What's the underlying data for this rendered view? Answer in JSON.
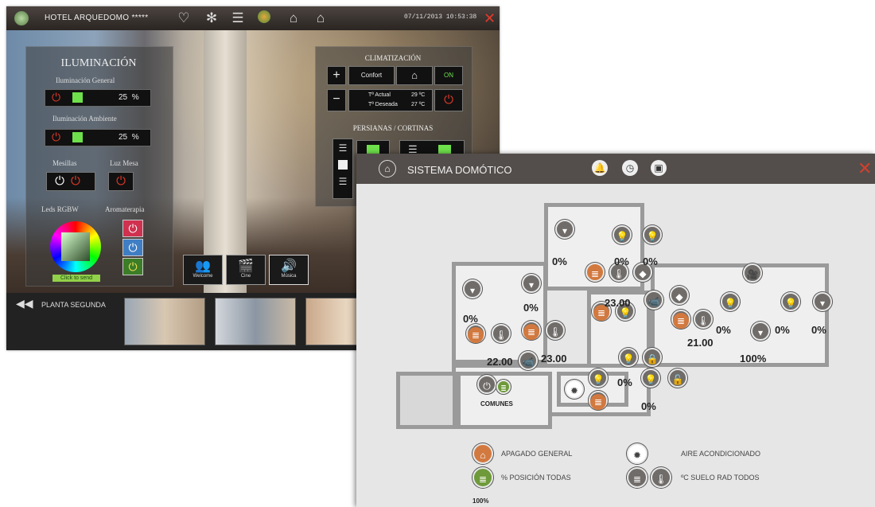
{
  "hotel": {
    "title": "HOTEL ARQUEDOMO *****",
    "datetime": "07/11/2013 10:53:38",
    "close": "✕",
    "toolbar_icons": [
      "bulb-icon",
      "snowflake-icon",
      "blinds-icon",
      "globe-icon",
      "camera-icon",
      "home-icon"
    ],
    "lighting": {
      "heading": "ILUMINACIÓN",
      "general_label": "Iluminación General",
      "general_value": "25",
      "ambient_label": "Iluminación Ambiente",
      "ambient_value": "25",
      "unit": "%",
      "mesillas_label": "Mesillas",
      "luz_mesa_label": "Luz Mesa",
      "leds_label": "Leds RGBW",
      "aroma_label": "Aromaterapia",
      "click_to_send": "Click to send"
    },
    "climate": {
      "heading": "CLIMATIZACIÓN",
      "mode": "Confort",
      "state": "ON",
      "actual_label": "Tª Actual",
      "actual_value": "29 ºC",
      "desired_label": "Tª Deseada",
      "desired_value": "27 ºC",
      "blinds_heading": "PERSIANAS / CORTINAS"
    },
    "scenes": [
      "Welcome",
      "Cine",
      "Música"
    ],
    "floor_label": "PLANTA SEGUNDA"
  },
  "domotic": {
    "title": "SISTEMA DOMÓTICO",
    "close": "✕",
    "percentages": [
      "0%",
      "0%",
      "0%",
      "0%",
      "0%",
      "0%",
      "0%",
      "0%",
      "0%",
      "0%",
      "100%"
    ],
    "temperatures": [
      "23.00",
      "21.00",
      "22.00",
      "23.00"
    ],
    "comunes_label": "COMUNES",
    "legend": {
      "off_all": "APAGADO GENERAL",
      "ac": "AIRE ACONDICIONADO",
      "pos_all": "% POSICIÓN TODAS",
      "floor_rad": "ºC SUELO RAD TODOS",
      "pos_value": "100%"
    }
  },
  "colors": {
    "accent_red": "#e23a2a",
    "active_green": "#6ee04b",
    "heating_orange": "#d2793f",
    "bar_dark": "#534e4b"
  }
}
